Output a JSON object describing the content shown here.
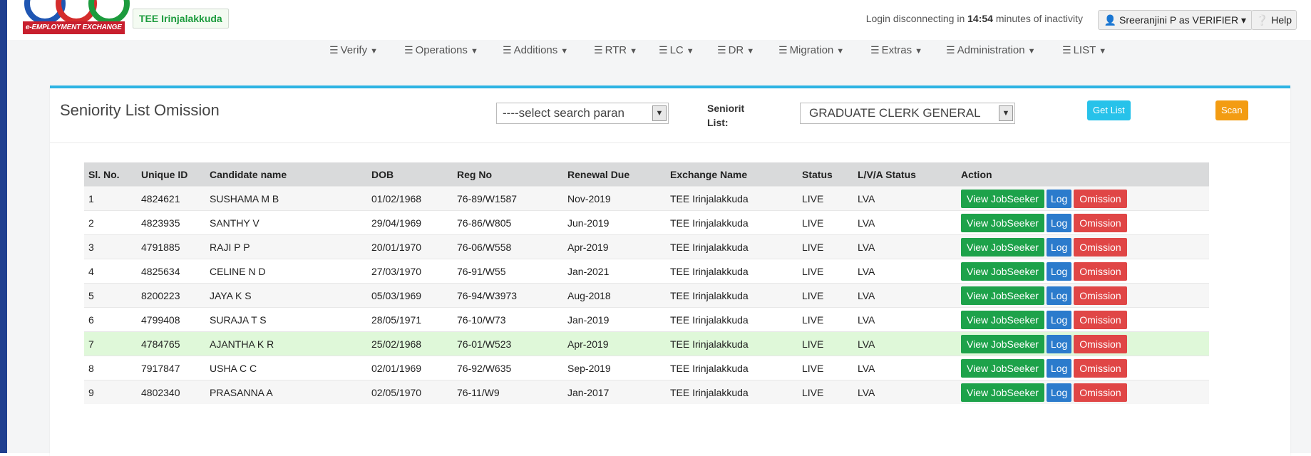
{
  "app": {
    "brand_text": "e-EMPLOYMENT EXCHANGE",
    "office": "TEE Irinjalakkuda"
  },
  "session": {
    "prefix": "Login disconnecting in",
    "time": "14:54",
    "suffix": "minutes of inactivity",
    "user": "Sreeranjini P as VERIFIER",
    "help": "Help"
  },
  "menu": [
    {
      "label": "Verify"
    },
    {
      "label": "Operations"
    },
    {
      "label": "Additions"
    },
    {
      "label": "RTR"
    },
    {
      "label": "LC"
    },
    {
      "label": "DR"
    },
    {
      "label": "Migration"
    },
    {
      "label": "Extras"
    },
    {
      "label": "Administration"
    },
    {
      "label": "LIST"
    }
  ],
  "panel": {
    "title": "Seniority List Omission",
    "search_select": "----select search paran",
    "seniority_label": "Seniorit List:",
    "list_select": "GRADUATE CLERK GENERAL",
    "get_list": "Get List",
    "scan": "Scan"
  },
  "table": {
    "headers": [
      "Sl. No.",
      "Unique ID",
      "Candidate name",
      "DOB",
      "Reg No",
      "Renewal Due",
      "Exchange Name",
      "Status",
      "L/V/A Status",
      "Action"
    ],
    "actions": {
      "view": "View JobSeeker",
      "log": "Log",
      "omit": "Omission"
    },
    "rows": [
      {
        "sl": "1",
        "uid": "4824621",
        "name": "SUSHAMA M B",
        "dob": "01/02/1968",
        "reg": "76-89/W1587",
        "renewal": "Nov-2019",
        "exchange": "TEE Irinjalakkuda",
        "status": "LIVE",
        "lva": "LVA"
      },
      {
        "sl": "2",
        "uid": "4823935",
        "name": "SANTHY V",
        "dob": "29/04/1969",
        "reg": "76-86/W805",
        "renewal": "Jun-2019",
        "exchange": "TEE Irinjalakkuda",
        "status": "LIVE",
        "lva": "LVA"
      },
      {
        "sl": "3",
        "uid": "4791885",
        "name": "RAJI P P",
        "dob": "20/01/1970",
        "reg": "76-06/W558",
        "renewal": "Apr-2019",
        "exchange": "TEE Irinjalakkuda",
        "status": "LIVE",
        "lva": "LVA"
      },
      {
        "sl": "4",
        "uid": "4825634",
        "name": "CELINE N D",
        "dob": "27/03/1970",
        "reg": "76-91/W55",
        "renewal": "Jan-2021",
        "exchange": "TEE Irinjalakkuda",
        "status": "LIVE",
        "lva": "LVA"
      },
      {
        "sl": "5",
        "uid": "8200223",
        "name": "JAYA K S",
        "dob": "05/03/1969",
        "reg": "76-94/W3973",
        "renewal": "Aug-2018",
        "exchange": "TEE Irinjalakkuda",
        "status": "LIVE",
        "lva": "LVA"
      },
      {
        "sl": "6",
        "uid": "4799408",
        "name": "SURAJA T S",
        "dob": "28/05/1971",
        "reg": "76-10/W73",
        "renewal": "Jan-2019",
        "exchange": "TEE Irinjalakkuda",
        "status": "LIVE",
        "lva": "LVA"
      },
      {
        "sl": "7",
        "uid": "4784765",
        "name": "AJANTHA K R",
        "dob": "25/02/1968",
        "reg": "76-01/W523",
        "renewal": "Apr-2019",
        "exchange": "TEE Irinjalakkuda",
        "status": "LIVE",
        "lva": "LVA"
      },
      {
        "sl": "8",
        "uid": "7917847",
        "name": "USHA C C",
        "dob": "02/01/1969",
        "reg": "76-92/W635",
        "renewal": "Sep-2019",
        "exchange": "TEE Irinjalakkuda",
        "status": "LIVE",
        "lva": "LVA"
      },
      {
        "sl": "9",
        "uid": "4802340",
        "name": "PRASANNA A",
        "dob": "02/05/1970",
        "reg": "76-11/W9",
        "renewal": "Jan-2017",
        "exchange": "TEE Irinjalakkuda",
        "status": "LIVE",
        "lva": "LVA"
      }
    ]
  }
}
